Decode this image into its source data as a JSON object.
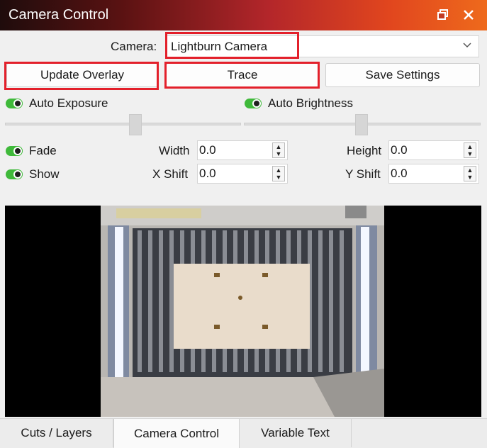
{
  "window": {
    "title": "Camera Control",
    "float_icon": "float-window-icon",
    "close_icon": "close-icon"
  },
  "camera": {
    "label": "Camera:",
    "selected": "Lightburn Camera",
    "dropdown_icon": "chevron-down-icon"
  },
  "buttons": {
    "update_overlay": "Update Overlay",
    "trace": "Trace",
    "save_settings": "Save Settings"
  },
  "toggles": {
    "auto_exposure": "Auto Exposure",
    "auto_brightness": "Auto Brightness",
    "fade": "Fade",
    "show": "Show"
  },
  "sliders": {
    "exposure_level": 0.5,
    "brightness_level": 0.5
  },
  "fields": {
    "width_label": "Width",
    "width_value": "0.0",
    "height_label": "Height",
    "height_value": "0.0",
    "xshift_label": "X Shift",
    "xshift_value": "0.0",
    "yshift_label": "Y Shift",
    "yshift_value": "0.0"
  },
  "tabs": [
    {
      "label": "Cuts / Layers"
    },
    {
      "label": "Camera Control"
    },
    {
      "label": "Variable Text"
    }
  ],
  "colors": {
    "highlight_outline": "#e3202b",
    "toggle_on": "#3fb93a"
  }
}
